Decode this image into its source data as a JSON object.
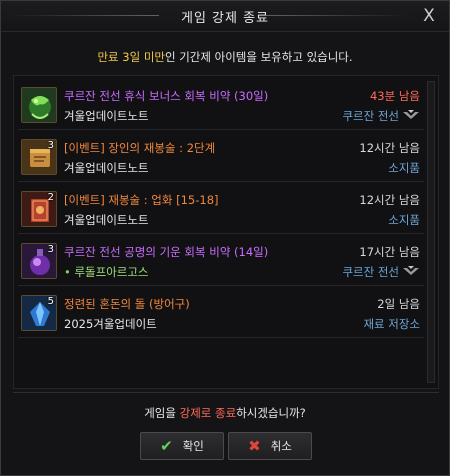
{
  "dialog": {
    "title": "게임 강제 종료",
    "close_glyph": "X"
  },
  "notice": {
    "highlight": "만료 3일 미만",
    "rest": "인 기간제 아이템을 보유하고 있습니다."
  },
  "items": [
    {
      "icon": "green-serpent-potion-icon",
      "count": "",
      "name": "쿠르잔 전선 휴식 보너스 회복 비약 (30일)",
      "name_color": "#c86dfd",
      "sub": "겨울업데이트노트",
      "time": "43분 남음",
      "time_color": "#ff6a5a",
      "storage": "쿠르잔 전선",
      "storage_icon": "kurzan-crest-icon"
    },
    {
      "icon": "scroll-bundle-icon",
      "count": "3",
      "name": "[이벤트] 장인의 재봉술 : 2단계",
      "name_color": "#f0883e",
      "sub": "겨울업데이트노트",
      "time": "12시간 남음",
      "time_color": "#e6e6e6",
      "storage": "소지품",
      "storage_icon": ""
    },
    {
      "icon": "red-tome-icon",
      "count": "2",
      "name": "[이벤트] 재봉술 : 업화 [15-18]",
      "name_color": "#f0883e",
      "sub": "겨울업데이트노트",
      "time": "12시간 남음",
      "time_color": "#e6e6e6",
      "storage": "소지품",
      "storage_icon": ""
    },
    {
      "icon": "purple-orb-potion-icon",
      "count": "3",
      "name": "쿠르잔 전선 공명의 기운 회복 비약 (14일)",
      "name_color": "#c86dfd",
      "sub": "루돌프아르고스",
      "sub_dot": "•",
      "time": "17시간 남음",
      "time_color": "#e6e6e6",
      "storage": "쿠르잔 전선",
      "storage_icon": "kurzan-crest-icon"
    },
    {
      "icon": "blue-chaos-stone-icon",
      "count": "5",
      "name": "정련된 혼돈의 돌 (방어구)",
      "name_color": "#f0883e",
      "sub": "2025겨울업데이트",
      "time": "2일 남음",
      "time_color": "#e6e6e6",
      "storage": "재료 저장소",
      "storage_icon": ""
    }
  ],
  "confirm": {
    "prefix": "게임을 ",
    "highlight": "강제로 종료",
    "suffix": "하시겠습니까?"
  },
  "buttons": {
    "ok_label": "확인",
    "ok_glyph": "✔",
    "cancel_label": "취소",
    "cancel_glyph": "✖"
  },
  "colors": {
    "accent_yellow": "#f2c94c",
    "danger_red": "#ff6a5a",
    "storage_blue": "#6ea6d6",
    "ok_green": "#5fd35f",
    "cancel_red": "#e0453a"
  }
}
